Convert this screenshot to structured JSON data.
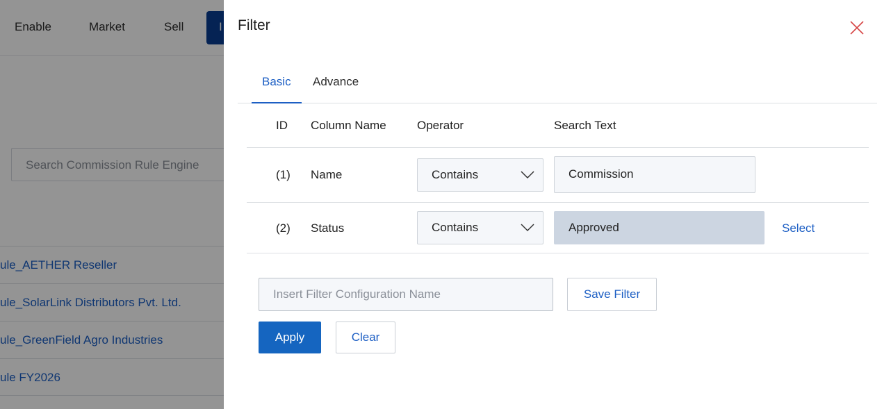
{
  "background": {
    "nav": {
      "items": [
        "Enable",
        "Market",
        "Sell"
      ],
      "active_item_partial": "I"
    },
    "search": {
      "placeholder": "Search Commission Rule Engine"
    },
    "rows": [
      "ule_AETHER Reseller",
      "ule_SolarLink Distributors Pvt. Ltd.",
      "ule_GreenField Agro Industries",
      "ule FY2026"
    ]
  },
  "drawer": {
    "title": "Filter",
    "close_icon": "close-icon",
    "close_color": "#d64545",
    "tabs": [
      {
        "label": "Basic",
        "active": true
      },
      {
        "label": "Advance",
        "active": false
      }
    ],
    "table": {
      "headers": {
        "id": "ID",
        "column": "Column Name",
        "operator": "Operator",
        "search": "Search Text"
      },
      "rows": [
        {
          "id": "(1)",
          "column": "Name",
          "operator": "Contains",
          "search": "Commission"
        },
        {
          "id": "(2)",
          "column": "Status",
          "operator": "Contains",
          "search": "Approved",
          "action": "Select"
        }
      ]
    },
    "config_input": {
      "placeholder": "Insert Filter Configuration Name",
      "value": ""
    },
    "buttons": {
      "save_filter": "Save Filter",
      "apply": "Apply",
      "clear": "Clear"
    }
  },
  "colors": {
    "accent": "#1d5fc4",
    "primary_button": "#1565c0",
    "nav_active": "#0a3d91"
  }
}
